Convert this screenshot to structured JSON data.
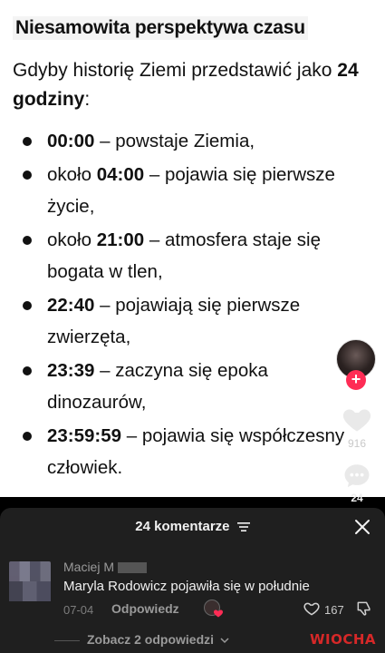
{
  "post": {
    "title": "Niesamowita perspektywa czasu",
    "intro_text": "Gdyby historię Ziemi przedstawić jako ",
    "intro_bold": "24 godziny",
    "intro_end": ":",
    "items": [
      {
        "prefix": "",
        "time": "00:00",
        "text": " – powstaje Ziemia,"
      },
      {
        "prefix": "około ",
        "time": "04:00",
        "text": " – pojawia się pierwsze życie,"
      },
      {
        "prefix": "około ",
        "time": "21:00",
        "text": " – atmosfera staje się bogata w tlen,"
      },
      {
        "prefix": "",
        "time": "22:40",
        "text": " – pojawiają się pierwsze zwierzęta,"
      },
      {
        "prefix": "",
        "time": "23:39",
        "text": " – zaczyna się epoka dinozaurów,"
      },
      {
        "prefix": "",
        "time": "23:59:59",
        "text": " – pojawia się współczesny człowiek."
      }
    ]
  },
  "rail": {
    "likes": "916",
    "comments": "24",
    "follow_symbol": "+"
  },
  "comments_sheet": {
    "header": "24 komentarze",
    "comment": {
      "user": "Maciej M",
      "text": "Maryla Rodowicz pojawiła się w południe",
      "date": "07-04",
      "reply_label": "Odpowiedz",
      "like_count": "167"
    },
    "view_replies": "Zobacz 2 odpowiedzi",
    "watermark": "WIOCHA"
  },
  "colors": {
    "accent": "#fe2c55",
    "sheet_bg": "#1f1f1f",
    "watermark": "#d62828"
  }
}
